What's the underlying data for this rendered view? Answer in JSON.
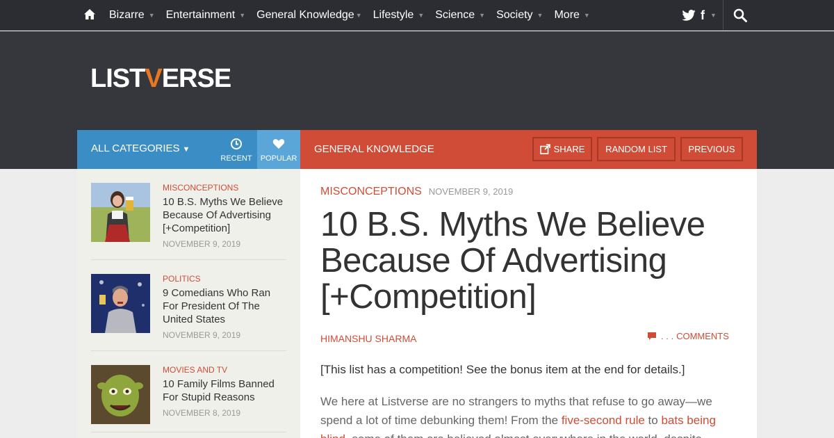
{
  "nav": {
    "items": [
      {
        "label": "Bizarre"
      },
      {
        "label": "Entertainment"
      },
      {
        "label": "General Knowledge"
      },
      {
        "label": "Lifestyle"
      },
      {
        "label": "Science"
      },
      {
        "label": "Society"
      },
      {
        "label": "More"
      }
    ],
    "facebook_glyph": "f"
  },
  "logo": {
    "before": "LIST",
    "accent": "V",
    "after": "ERSE",
    "accent_color": "#e87722"
  },
  "catbar": {
    "all_categories": "All Categories",
    "recent": "Recent",
    "popular": "Popular",
    "section": "General Knowledge",
    "share": "Share",
    "random": "Random List",
    "previous": "Previous"
  },
  "sidebar": {
    "items": [
      {
        "category": "Misconceptions",
        "title": "10 B.S. Myths We Believe Because Of Advertising [+Competition]",
        "date": "November 9, 2019"
      },
      {
        "category": "Politics",
        "title": "9 Comedians Who Ran For President Of The United States",
        "date": "November 9, 2019"
      },
      {
        "category": "Movies and TV",
        "title": "10 Family Films Banned For Stupid Reasons",
        "date": "November 8, 2019"
      }
    ]
  },
  "article": {
    "category": "Misconceptions",
    "date": "November 9, 2019",
    "title": "10 B.S. Myths We Believe Because Of Advertising [+Competition]",
    "author": "Himanshu Sharma",
    "comments_dots": ". . .",
    "comments_label": "Comments",
    "intro": "[This list has a competition! See the bonus item at the end for details.]",
    "para_start": "We here at Listverse are no strangers to myths that refuse to go away—we spend a lot of time debunking them! From the ",
    "link1": "five-second rule",
    "para_mid": " to ",
    "link2": "bats being blind",
    "para_end": ", some of them are believed almost everywhere in the world, despite"
  },
  "colors": {
    "accent_red": "#d04c36",
    "accent_blue": "#3a8ec5",
    "nav_bg": "#2b2d33",
    "header_bg": "#35373d"
  }
}
